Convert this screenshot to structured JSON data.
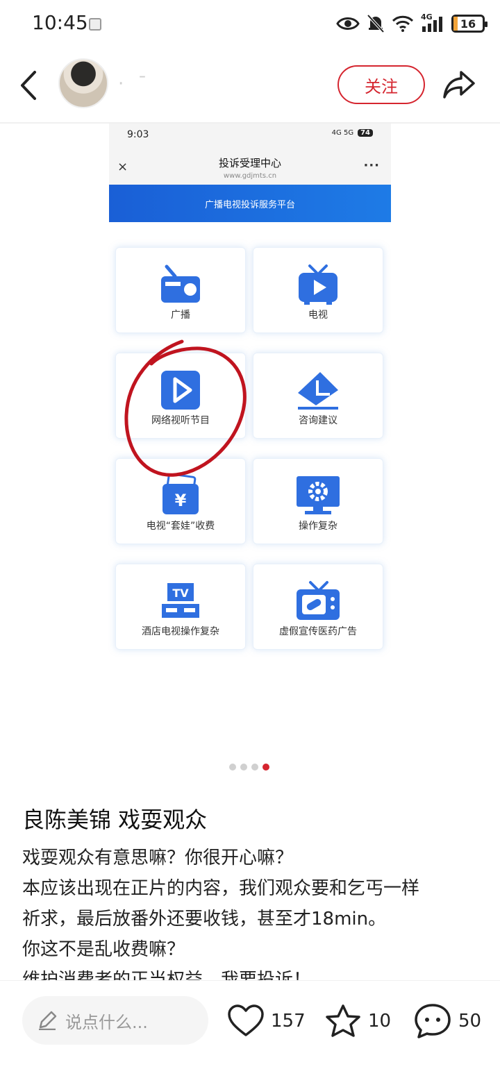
{
  "status_bar": {
    "time": "10:45",
    "network": "4G",
    "battery": "16"
  },
  "header": {
    "username": "· ˉ",
    "follow_label": "关注"
  },
  "screenshot": {
    "time": "9:03",
    "signal_text": "4G 5G",
    "battery": "74",
    "title": "投诉受理中心",
    "url": "www.gdjmts.cn",
    "more": "···",
    "close": "×",
    "banner": "广播电视投诉服务平台",
    "tiles": [
      {
        "label": "广播",
        "icon": "radio-icon"
      },
      {
        "label": "电视",
        "icon": "tv-play-icon"
      },
      {
        "label": "网络视听节目",
        "icon": "video-play-icon"
      },
      {
        "label": "咨询建议",
        "icon": "envelope-icon"
      },
      {
        "label": "电视“套娃”收费",
        "icon": "wallet-yuan-icon"
      },
      {
        "label": "操作复杂",
        "icon": "monitor-gear-icon"
      },
      {
        "label": "酒店电视操作复杂",
        "icon": "tv-stand-icon"
      },
      {
        "label": "虚假宣传医药广告",
        "icon": "tv-pill-icon"
      }
    ]
  },
  "pager": {
    "count": 4,
    "active": 4
  },
  "post": {
    "title": "良陈美锦 戏耍观众",
    "lines": [
      "戏耍观众有意思嘛？你很开心嘛？",
      "本应该出现在正片的内容，我们观众要和乞丐一样",
      "祈求，最后放番外还要收钱，甚至才18min。",
      "你这不是乱收费嘛？",
      "维护消费者的正当权益，我要投诉！"
    ]
  },
  "bottom_bar": {
    "comment_placeholder": "说点什么...",
    "likes": "157",
    "favorites": "10",
    "comments": "50"
  },
  "colors": {
    "accent": "#d5252f",
    "blue": "#2f6fe0"
  }
}
